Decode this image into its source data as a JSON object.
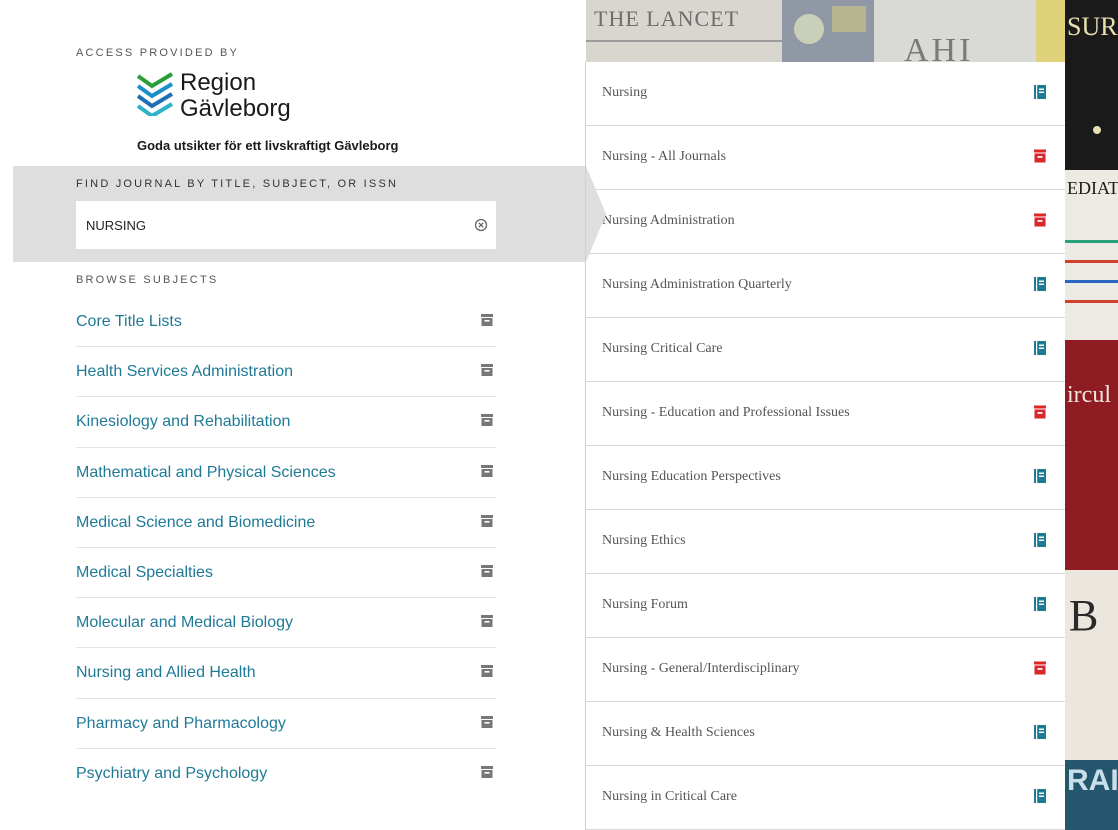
{
  "access": {
    "label": "ACCESS PROVIDED BY",
    "logo_line1": "Region",
    "logo_line2": "Gävleborg",
    "tagline": "Goda utsikter för ett livskraftigt Gävleborg"
  },
  "search": {
    "label": "FIND JOURNAL BY TITLE, SUBJECT, OR ISSN",
    "value": "NURSING",
    "clear_icon": "clear-circle-icon"
  },
  "browse": {
    "label": "BROWSE SUBJECTS",
    "subjects": [
      {
        "label": "Core Title Lists",
        "icon": "archive-icon"
      },
      {
        "label": "Health Services Administration",
        "icon": "archive-icon"
      },
      {
        "label": "Kinesiology and Rehabilitation",
        "icon": "archive-icon"
      },
      {
        "label": "Mathematical and Physical Sciences",
        "icon": "archive-icon"
      },
      {
        "label": "Medical Science and Biomedicine",
        "icon": "archive-icon"
      },
      {
        "label": "Medical Specialties",
        "icon": "archive-icon"
      },
      {
        "label": "Molecular and Medical Biology",
        "icon": "archive-icon"
      },
      {
        "label": "Nursing and Allied Health",
        "icon": "archive-icon"
      },
      {
        "label": "Pharmacy and Pharmacology",
        "icon": "archive-icon"
      },
      {
        "label": "Psychiatry and Psychology",
        "icon": "archive-icon"
      }
    ]
  },
  "results": [
    {
      "title": "Nursing",
      "icon": "journal-icon"
    },
    {
      "title": "Nursing - All Journals",
      "icon": "archive-icon"
    },
    {
      "title": "Nursing Administration",
      "icon": "archive-icon"
    },
    {
      "title": "Nursing Administration Quarterly",
      "icon": "journal-icon"
    },
    {
      "title": "Nursing Critical Care",
      "icon": "journal-icon"
    },
    {
      "title": "Nursing - Education and Professional Issues",
      "icon": "archive-icon"
    },
    {
      "title": "Nursing Education Perspectives",
      "icon": "journal-icon"
    },
    {
      "title": "Nursing Ethics",
      "icon": "journal-icon"
    },
    {
      "title": "Nursing Forum",
      "icon": "journal-icon"
    },
    {
      "title": "Nursing - General/Interdisciplinary",
      "icon": "archive-icon"
    },
    {
      "title": "Nursing & Health Sciences",
      "icon": "journal-icon"
    },
    {
      "title": "Nursing in Critical Care",
      "icon": "journal-icon"
    }
  ],
  "background_covers": {
    "lancet": "THE LANCET",
    "ahi": "AHI",
    "surg": "SURG",
    "pediat": "EDIAT",
    "circul": "ircul",
    "jbone": "B",
    "rai": "RAI"
  },
  "colors": {
    "link": "#1f7a96",
    "journal_icon": "#1f7a96",
    "archive_icon_results": "#d9262c",
    "archive_icon_subjects": "#777777",
    "search_band": "#dedede"
  }
}
